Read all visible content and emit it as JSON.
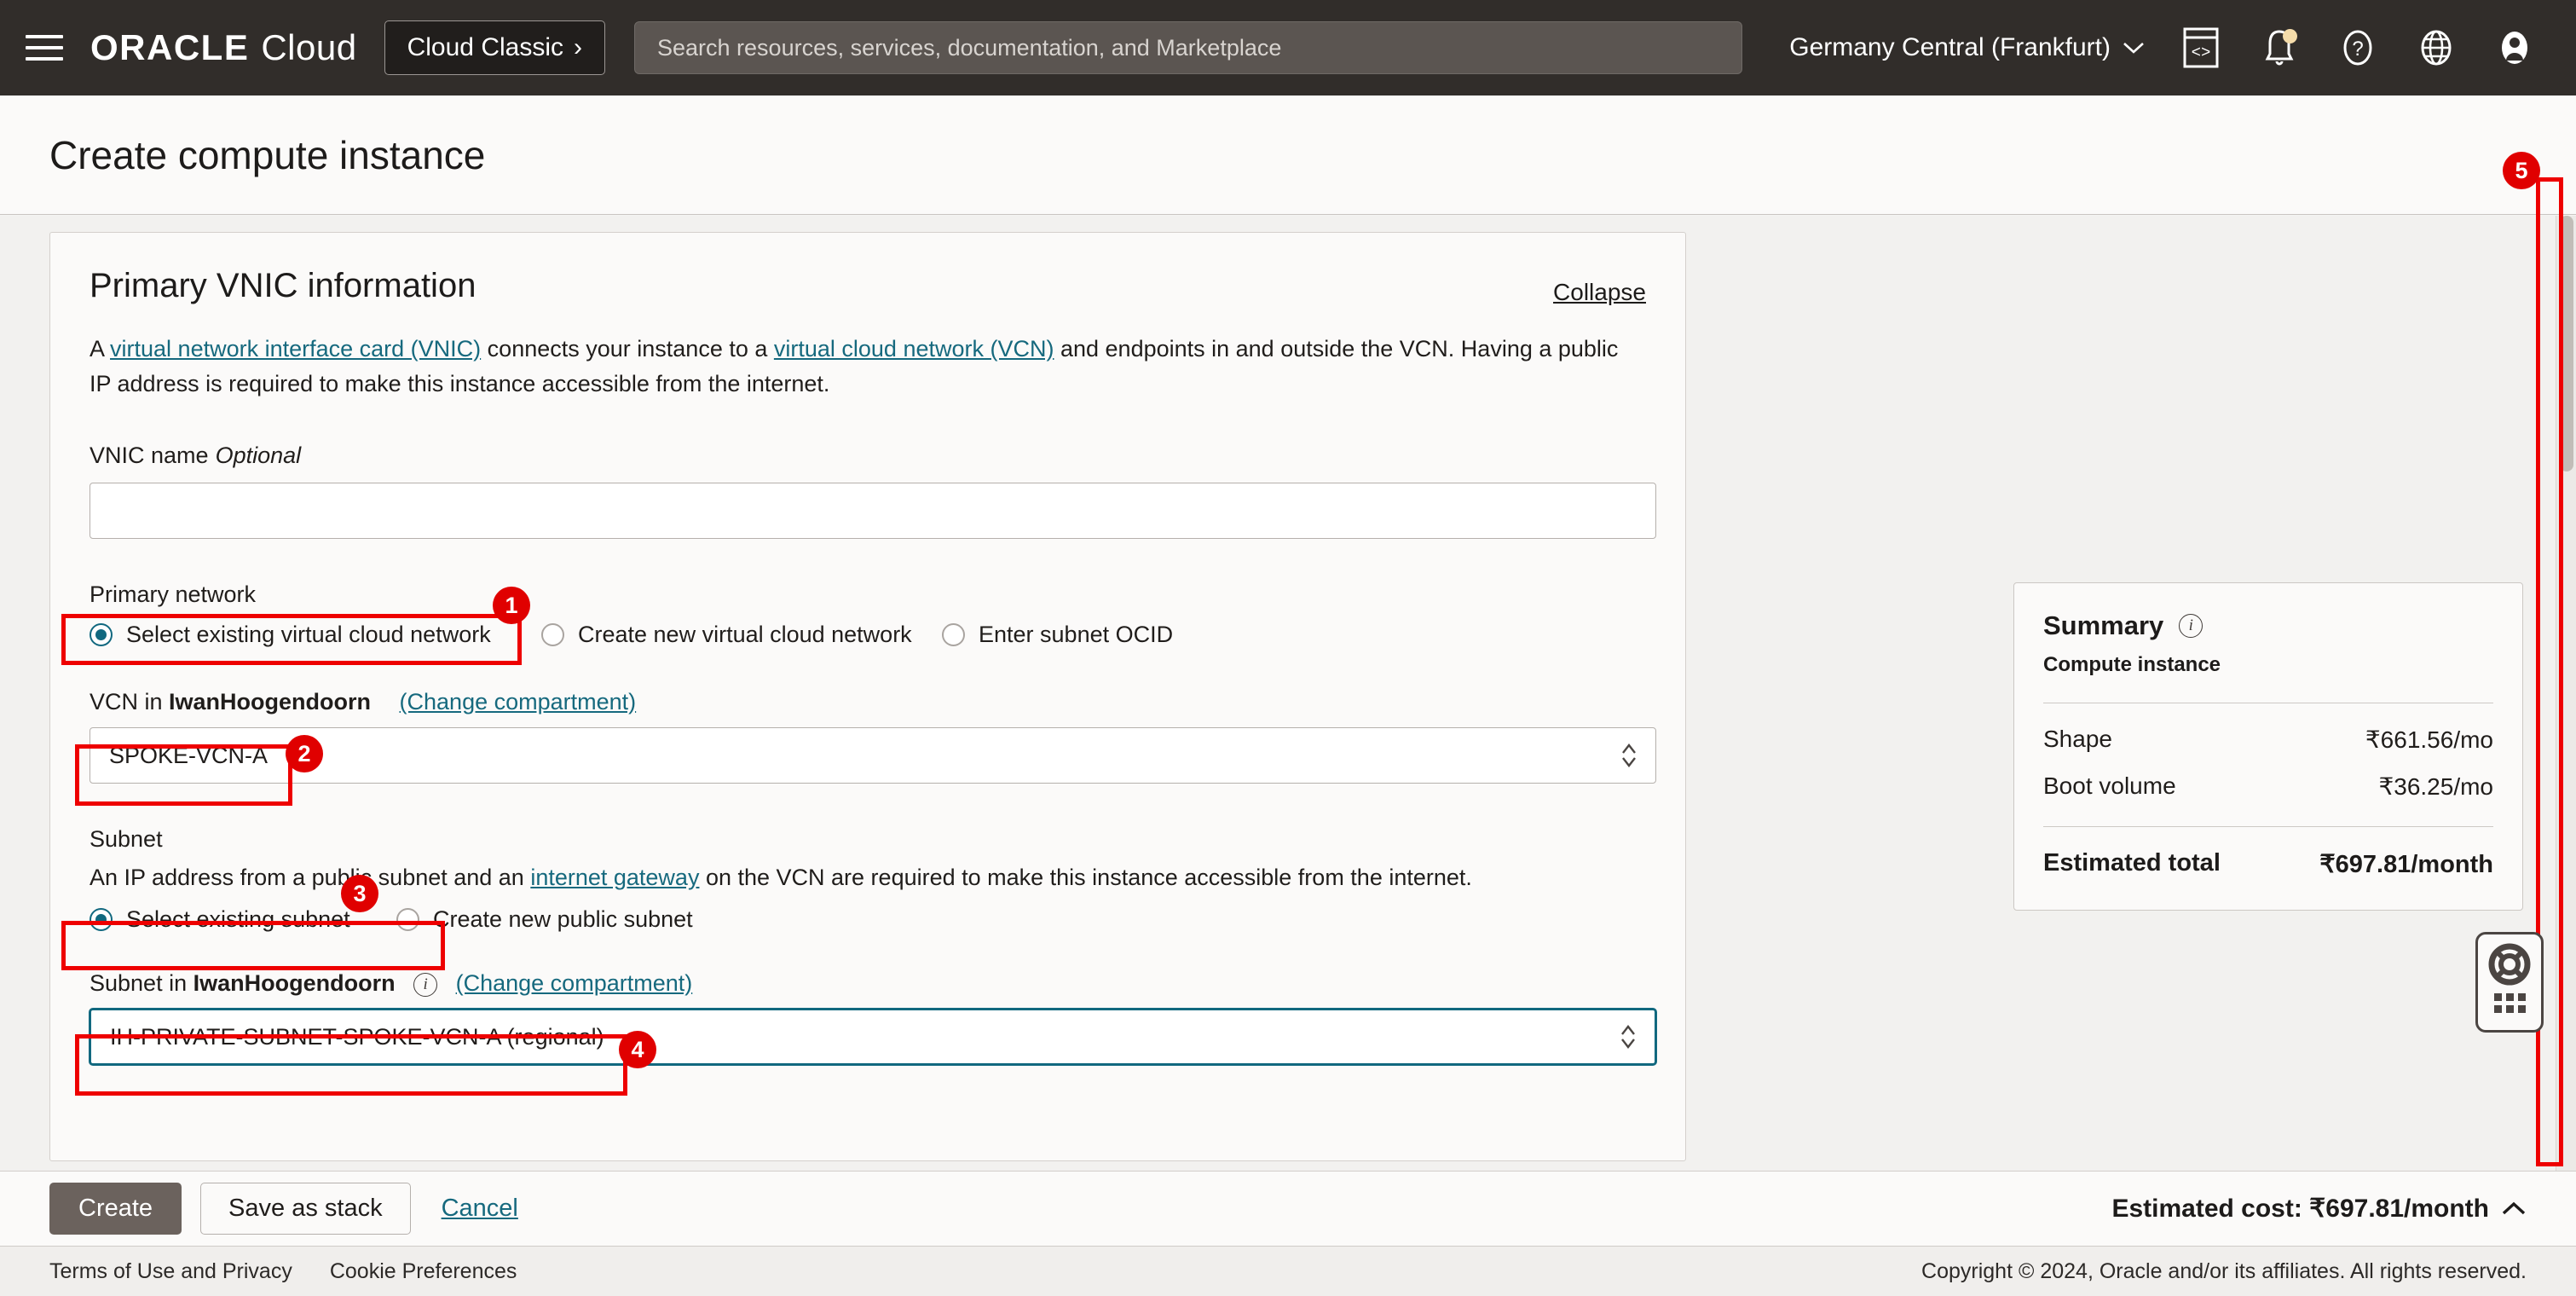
{
  "topnav": {
    "menu_icon": "hamburger-menu-icon",
    "brand_oracle": "ORACLE",
    "brand_cloud": "Cloud",
    "cloud_classic_label": "Cloud Classic",
    "cloud_classic_chevron": "›",
    "search_placeholder": "Search resources, services, documentation, and Marketplace",
    "region_label": "Germany Central (Frankfurt)",
    "region_chevron": "⌄",
    "icons": [
      "cloud-shell-icon",
      "notifications-bell-icon",
      "help-question-icon",
      "language-globe-icon",
      "user-avatar-icon"
    ]
  },
  "page": {
    "title": "Create compute instance"
  },
  "panel": {
    "title": "Primary VNIC information",
    "collapse_label": "Collapse",
    "desc_prefix": "A ",
    "desc_link1": "virtual network interface card (VNIC)",
    "desc_mid": " connects your instance to a ",
    "desc_link2": "virtual cloud network (VCN)",
    "desc_suffix": " and endpoints in and outside the VCN. Having a public IP address is required to make this instance accessible from the internet.",
    "vnic_name_label": "VNIC name",
    "vnic_name_optional": "Optional",
    "vnic_name_value": "",
    "primary_network_label": "Primary network",
    "primary_network_options": [
      {
        "label": "Select existing virtual cloud network",
        "checked": true
      },
      {
        "label": "Create new virtual cloud network",
        "checked": false
      },
      {
        "label": "Enter subnet OCID",
        "checked": false
      }
    ],
    "vcn_label_prefix": "VCN in ",
    "vcn_compartment": "IwanHoogendoorn",
    "vcn_change_compartment": "(Change compartment)",
    "vcn_value": "SPOKE-VCN-A",
    "subnet_group_label": "Subnet",
    "subnet_desc_prefix": "An IP address from a public subnet and an ",
    "subnet_desc_link": "internet gateway",
    "subnet_desc_suffix": " on the VCN are required to make this instance accessible from the internet.",
    "subnet_options": [
      {
        "label": "Select existing subnet",
        "checked": true
      },
      {
        "label": "Create new public subnet",
        "checked": false
      }
    ],
    "subnet_label_prefix": "Subnet in ",
    "subnet_compartment": "IwanHoogendoorn",
    "subnet_info_icon": "info-icon",
    "subnet_change_compartment": "(Change compartment)",
    "subnet_value": "IH-PRIVATE-SUBNET-SPOKE-VCN-A (regional)"
  },
  "summary": {
    "title": "Summary",
    "info_icon": "info-icon",
    "subtitle": "Compute instance",
    "rows": [
      {
        "label": "Shape",
        "value": "₹661.56/mo"
      },
      {
        "label": "Boot volume",
        "value": "₹36.25/mo"
      }
    ],
    "total_label": "Estimated total",
    "total_value": "₹697.81/month"
  },
  "help_widget": {
    "icon": "lifebuoy-support-icon",
    "handle": "drag-handle-dots"
  },
  "action_bar": {
    "create_label": "Create",
    "save_stack_label": "Save as stack",
    "cancel_label": "Cancel",
    "estimated_cost": "Estimated cost: ₹697.81/month",
    "estimated_cost_chevron": "⌃"
  },
  "footer": {
    "terms_label": "Terms of Use and Privacy",
    "cookie_label": "Cookie Preferences",
    "copyright": "Copyright © 2024, Oracle and/or its affiliates. All rights reserved."
  },
  "annotations": {
    "markers": [
      "1",
      "2",
      "3",
      "4",
      "5"
    ]
  },
  "colors": {
    "annotation_red": "#ee0000",
    "accent_teal": "#11687f",
    "link_blue": "#16697e",
    "nav_dark": "#312d2a"
  }
}
